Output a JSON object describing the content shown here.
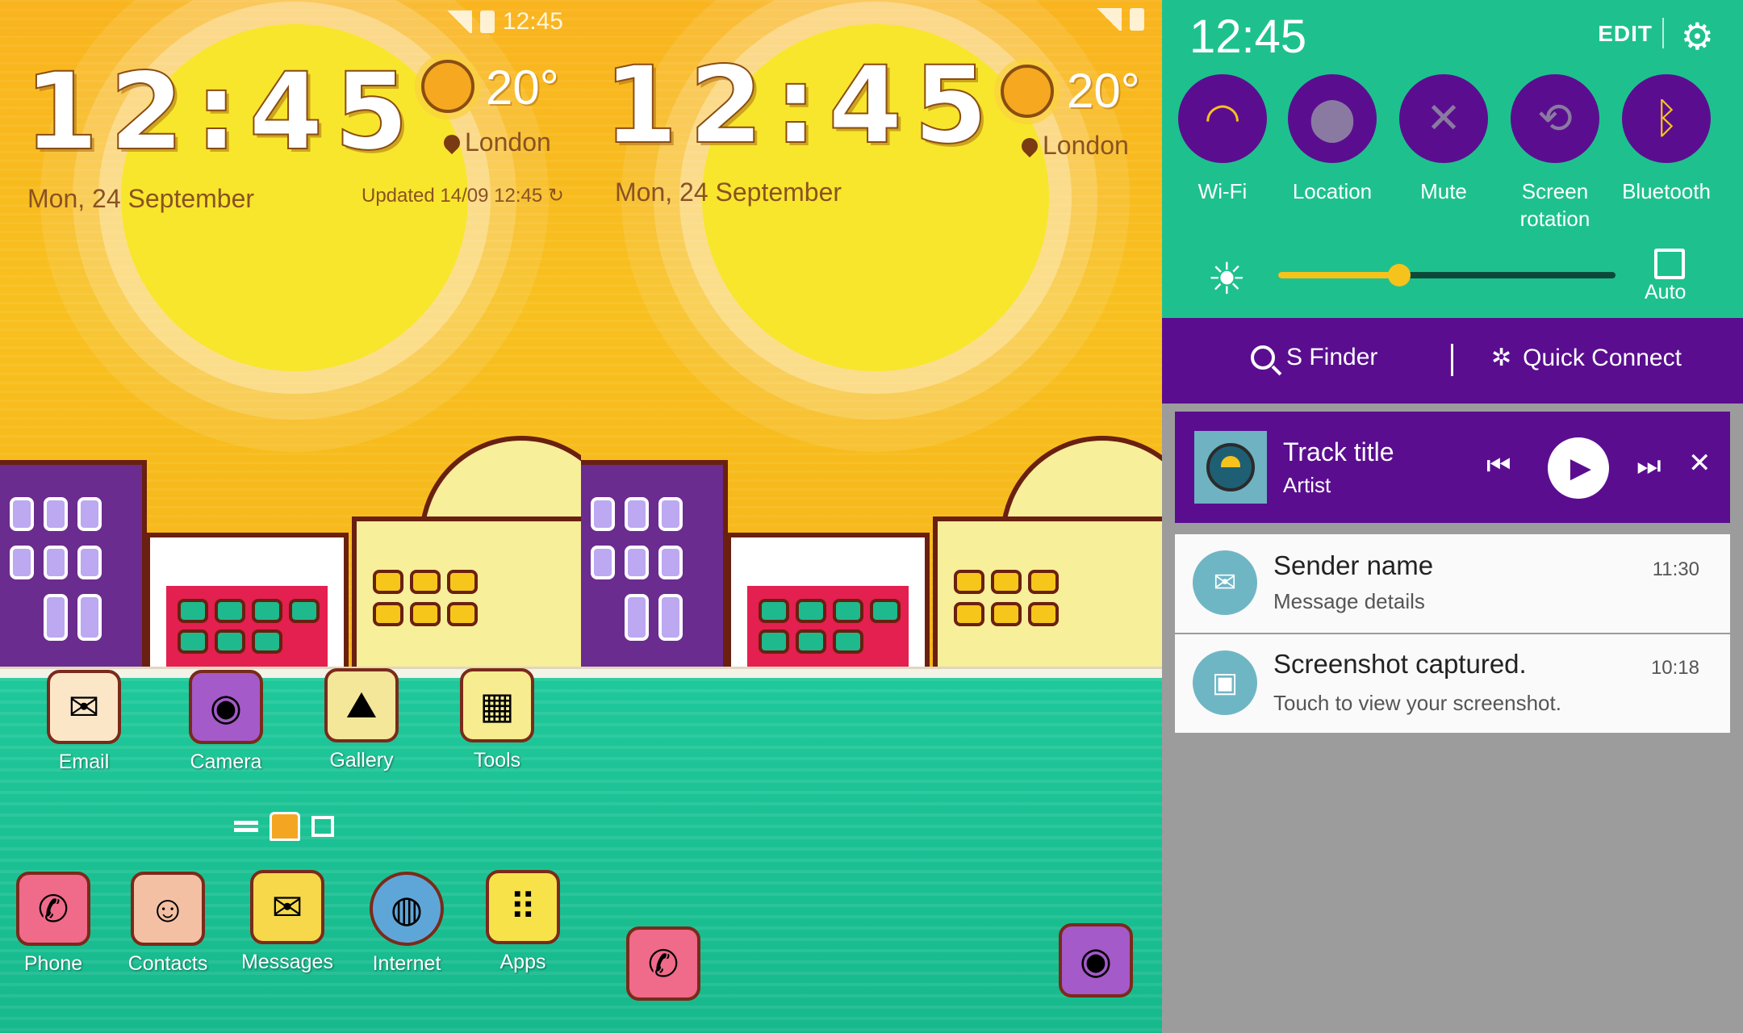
{
  "home_screen": {
    "clock": "12:45",
    "date": "Mon, 24 September",
    "weather": {
      "temperature": "20°",
      "location": "London",
      "updated": "Updated 14/09 12:45"
    },
    "status_bar": {
      "time": "12:45"
    },
    "apps": [
      {
        "label": "Email",
        "icon": "email-icon"
      },
      {
        "label": "Camera",
        "icon": "camera-icon"
      },
      {
        "label": "Gallery",
        "icon": "gallery-icon"
      },
      {
        "label": "Tools",
        "icon": "tools-folder-icon"
      }
    ],
    "dock": [
      {
        "label": "Phone",
        "icon": "phone-icon"
      },
      {
        "label": "Contacts",
        "icon": "contacts-icon"
      },
      {
        "label": "Messages",
        "icon": "messages-icon"
      },
      {
        "label": "Internet",
        "icon": "internet-globe-icon"
      },
      {
        "label": "Apps",
        "icon": "apps-grid-icon"
      }
    ]
  },
  "lock_screen": {
    "clock": "12:45",
    "date": "Mon, 24 September",
    "weather": {
      "temperature": "20°",
      "location": "London"
    },
    "shortcuts": [
      {
        "icon": "phone-icon"
      },
      {
        "icon": "camera-icon"
      }
    ]
  },
  "notification_panel": {
    "time": "12:45",
    "edit_label": "EDIT",
    "tiles": [
      {
        "label": "Wi-Fi",
        "icon": "wifi-icon"
      },
      {
        "label": "Location",
        "icon": "location-pin-icon"
      },
      {
        "label": "Mute",
        "icon": "mute-icon"
      },
      {
        "label": "Screen rotation",
        "icon": "screen-rotation-icon"
      },
      {
        "label": "Bluetooth",
        "icon": "bluetooth-icon"
      }
    ],
    "brightness": {
      "level": 0.36,
      "auto_label": "Auto"
    },
    "s_finder_label": "S Finder",
    "quick_connect_label": "Quick Connect",
    "music": {
      "title": "Track title",
      "artist": "Artist"
    },
    "notifications": [
      {
        "title": "Sender name",
        "text": "Message details",
        "time": "11:30",
        "icon": "email-icon"
      },
      {
        "title": "Screenshot captured.",
        "text": "Touch to view your screenshot.",
        "time": "10:18",
        "icon": "image-icon"
      }
    ]
  },
  "colors": {
    "sky": "#f8c01e",
    "sea": "#1ec18d",
    "quick_settings_bg": "#1ec18d",
    "accent_purple": "#5a0e8f",
    "slider": "#f6c21c"
  }
}
